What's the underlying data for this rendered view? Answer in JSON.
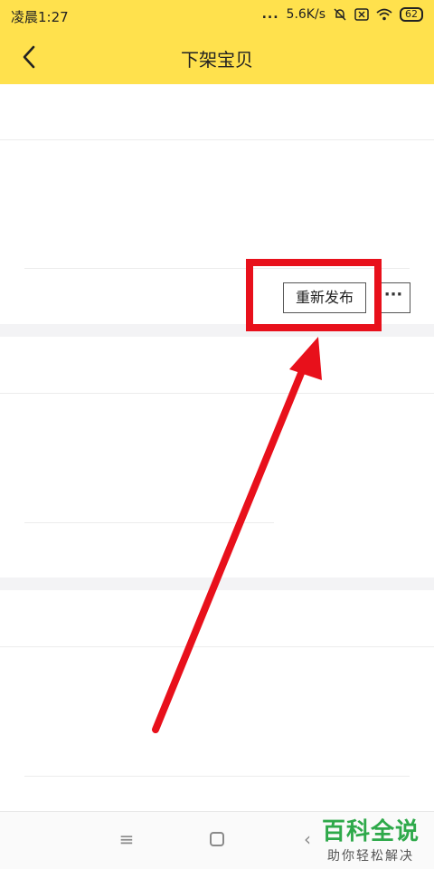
{
  "status_bar": {
    "time": "凌晨1:27",
    "signal_dots": "...",
    "network_speed": "5.6K/s",
    "battery": "62"
  },
  "nav": {
    "title": "下架宝贝"
  },
  "listing_actions": {
    "relist_label": "重新发布",
    "more_label": "···"
  },
  "watermark": {
    "brand": "百科全说",
    "tagline": "助你轻松解决"
  },
  "colors": {
    "header_yellow": "#ffe14d",
    "highlight_red": "#e8101b"
  },
  "icons": [
    "back-icon",
    "mute-icon",
    "sim-icon",
    "wifi-icon",
    "battery-icon",
    "menu-icon",
    "home-icon",
    "back-nav-icon"
  ]
}
